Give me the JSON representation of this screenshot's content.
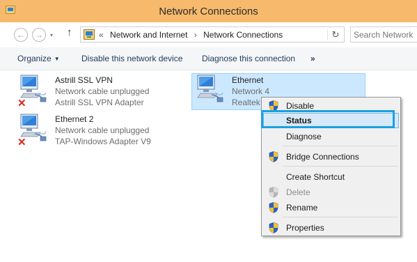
{
  "window": {
    "title": "Network Connections"
  },
  "nav": {
    "back_icon": "back-arrow-icon",
    "forward_icon": "forward-arrow-icon",
    "up_icon": "up-arrow-icon",
    "breadcrumb_prefix": "«",
    "breadcrumbs": [
      "Network and Internet",
      "Network Connections"
    ],
    "breadcrumb_separator": "›",
    "search_placeholder": "Search Network"
  },
  "toolbar": {
    "organize": "Organize",
    "disable": "Disable this network device",
    "diagnose": "Diagnose this connection",
    "more": "»"
  },
  "adapters": [
    {
      "name": "Astrill SSL VPN",
      "status": "Network cable unplugged",
      "device": "Astrill SSL VPN Adapter"
    },
    {
      "name": "Ethernet 2",
      "status": "Network cable unplugged",
      "device": "TAP-Windows Adapter V9"
    },
    {
      "name": "Ethernet",
      "status": "Network  4",
      "device": "Realtek"
    }
  ],
  "context_menu": {
    "items": [
      {
        "label": "Disable",
        "shield": true,
        "enabled": true
      },
      {
        "label": "Status",
        "shield": false,
        "enabled": true,
        "default": true
      },
      {
        "label": "Diagnose",
        "shield": false,
        "enabled": true
      },
      {
        "label": "Bridge Connections",
        "shield": true,
        "enabled": true
      },
      {
        "label": "Create Shortcut",
        "shield": false,
        "enabled": true
      },
      {
        "label": "Delete",
        "shield": true,
        "enabled": false
      },
      {
        "label": "Rename",
        "shield": true,
        "enabled": true
      },
      {
        "label": "Properties",
        "shield": true,
        "enabled": true
      }
    ]
  },
  "colors": {
    "titlebar": "#f7ba6d",
    "selection": "#cce8ff",
    "highlight_border": "#1aa0e2",
    "unplugged_x": "#d9261c"
  }
}
